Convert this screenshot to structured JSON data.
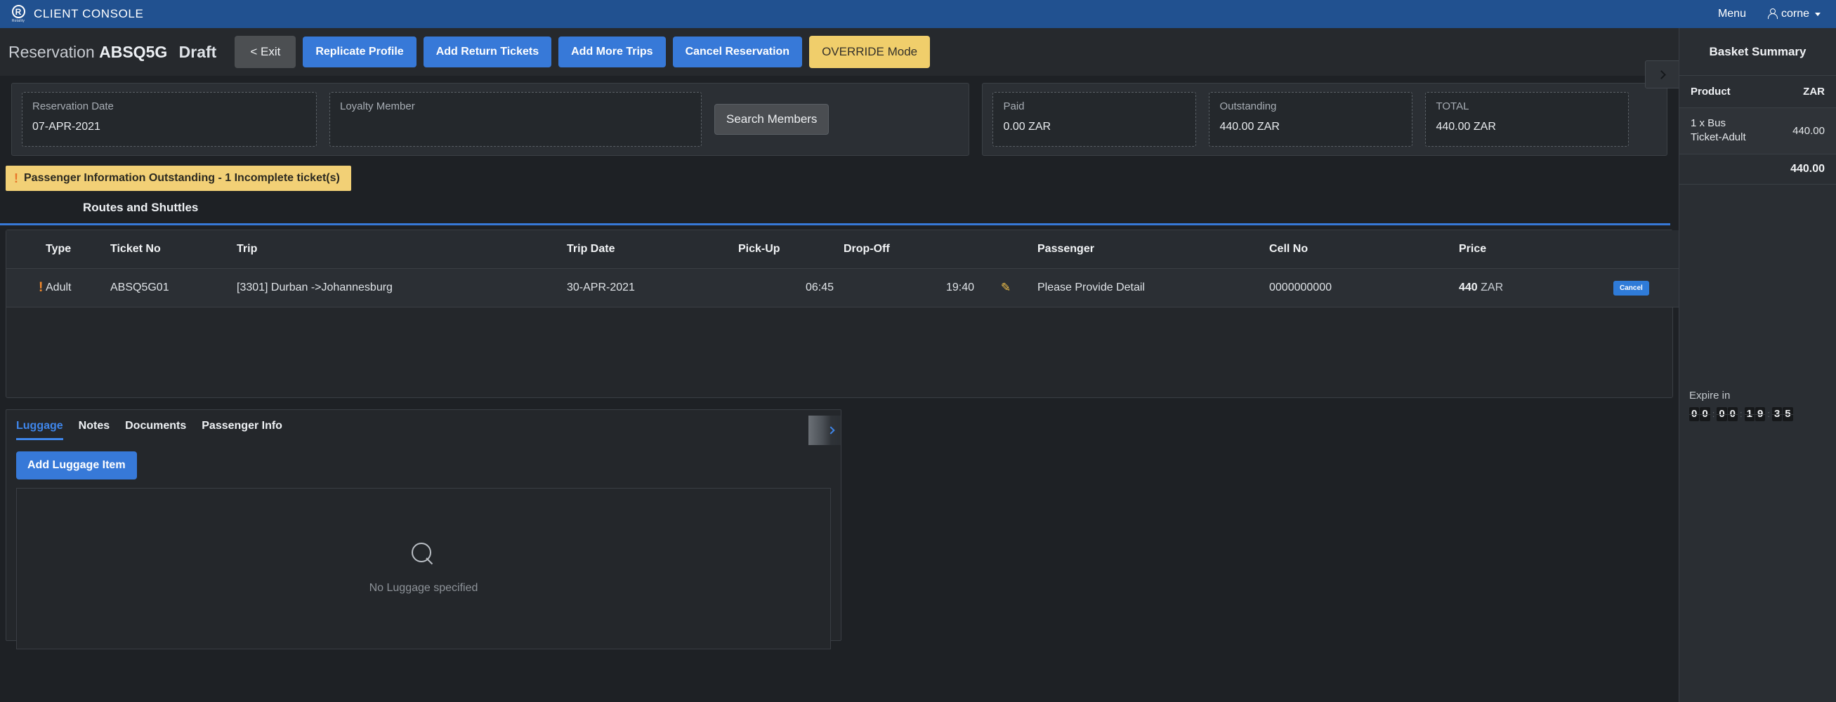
{
  "topbar": {
    "logo_letter": "R",
    "logo_word": "Rotality",
    "app_title": "CLIENT CONSOLE",
    "menu_label": "Menu",
    "user_name": "corne"
  },
  "action_header": {
    "reservation_word": "Reservation",
    "reservation_code": "ABSQ5G",
    "status": "Draft",
    "buttons": [
      {
        "label": "< Exit",
        "style": "grey"
      },
      {
        "label": "Replicate Profile",
        "style": "blue"
      },
      {
        "label": "Add Return Tickets",
        "style": "blue"
      },
      {
        "label": "Add More Trips",
        "style": "blue"
      },
      {
        "label": "Cancel Reservation",
        "style": "blue"
      },
      {
        "label": "OVERRIDE Mode",
        "style": "yellow"
      }
    ]
  },
  "fields": {
    "reservation_date": {
      "label": "Reservation Date",
      "value": "07-APR-2021"
    },
    "loyalty_member": {
      "label": "Loyalty Member",
      "value": ""
    },
    "search_members_label": "Search Members",
    "paid": {
      "label": "Paid",
      "value": "0.00 ZAR"
    },
    "outstanding": {
      "label": "Outstanding",
      "value": "440.00 ZAR"
    },
    "total": {
      "label": "TOTAL",
      "value": "440.00 ZAR"
    }
  },
  "warning": {
    "icon": "exclamation-icon",
    "text": "Passenger Information Outstanding - 1 Incomplete ticket(s)"
  },
  "routes_tab": {
    "label": "Routes and Shuttles"
  },
  "table": {
    "columns": [
      "Type",
      "Ticket No",
      "Trip",
      "Trip Date",
      "Pick-Up",
      "Drop-Off",
      "Passenger",
      "Cell No",
      "Price"
    ],
    "rows": [
      {
        "flag": "!",
        "type": "Adult",
        "ticket_no": "ABSQ5G01",
        "trip": "[3301] Durban ->Johannesburg",
        "trip_date": "30-APR-2021",
        "pickup": "06:45",
        "dropoff": "19:40",
        "edit_icon": "pencil-icon",
        "passenger": "Please Provide Detail",
        "cell_no": "0000000000",
        "price_amount": "440",
        "price_currency": "ZAR",
        "action_label": "Cancel"
      }
    ]
  },
  "lower_panel": {
    "tabs": [
      {
        "label": "Luggage",
        "active": true
      },
      {
        "label": "Notes",
        "active": false
      },
      {
        "label": "Documents",
        "active": false
      },
      {
        "label": "Passenger Info",
        "active": false
      }
    ],
    "add_button_label": "Add Luggage Item",
    "empty_icon": "search-icon",
    "empty_text": "No Luggage specified"
  },
  "basket": {
    "title": "Basket Summary",
    "col_product": "Product",
    "col_currency": "ZAR",
    "items": [
      {
        "product": "1 x Bus Ticket-Adult",
        "amount": "440.00"
      }
    ],
    "total": "440.00",
    "expire_label": "Expire in",
    "expire_digits": [
      "0",
      "0",
      "0",
      "0",
      "1",
      "9",
      "3",
      "5"
    ]
  },
  "colors": {
    "brand_blue": "#215190",
    "accent_blue": "#3779d8",
    "warning_yellow": "#f2d076",
    "override_yellow": "#f0ce6b",
    "alert_orange": "#f2892c",
    "panel_bg": "#2b2f34",
    "page_bg": "#1e2125"
  }
}
